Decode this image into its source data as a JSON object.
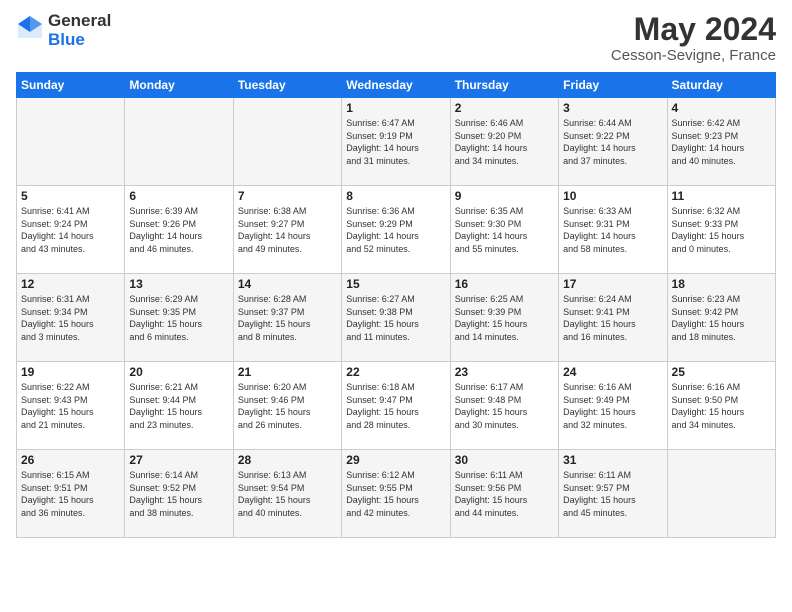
{
  "logo": {
    "general": "General",
    "blue": "Blue"
  },
  "title": "May 2024",
  "subtitle": "Cesson-Sevigne, France",
  "headers": [
    "Sunday",
    "Monday",
    "Tuesday",
    "Wednesday",
    "Thursday",
    "Friday",
    "Saturday"
  ],
  "weeks": [
    [
      {
        "day": "",
        "info": ""
      },
      {
        "day": "",
        "info": ""
      },
      {
        "day": "",
        "info": ""
      },
      {
        "day": "1",
        "info": "Sunrise: 6:47 AM\nSunset: 9:19 PM\nDaylight: 14 hours\nand 31 minutes."
      },
      {
        "day": "2",
        "info": "Sunrise: 6:46 AM\nSunset: 9:20 PM\nDaylight: 14 hours\nand 34 minutes."
      },
      {
        "day": "3",
        "info": "Sunrise: 6:44 AM\nSunset: 9:22 PM\nDaylight: 14 hours\nand 37 minutes."
      },
      {
        "day": "4",
        "info": "Sunrise: 6:42 AM\nSunset: 9:23 PM\nDaylight: 14 hours\nand 40 minutes."
      }
    ],
    [
      {
        "day": "5",
        "info": "Sunrise: 6:41 AM\nSunset: 9:24 PM\nDaylight: 14 hours\nand 43 minutes."
      },
      {
        "day": "6",
        "info": "Sunrise: 6:39 AM\nSunset: 9:26 PM\nDaylight: 14 hours\nand 46 minutes."
      },
      {
        "day": "7",
        "info": "Sunrise: 6:38 AM\nSunset: 9:27 PM\nDaylight: 14 hours\nand 49 minutes."
      },
      {
        "day": "8",
        "info": "Sunrise: 6:36 AM\nSunset: 9:29 PM\nDaylight: 14 hours\nand 52 minutes."
      },
      {
        "day": "9",
        "info": "Sunrise: 6:35 AM\nSunset: 9:30 PM\nDaylight: 14 hours\nand 55 minutes."
      },
      {
        "day": "10",
        "info": "Sunrise: 6:33 AM\nSunset: 9:31 PM\nDaylight: 14 hours\nand 58 minutes."
      },
      {
        "day": "11",
        "info": "Sunrise: 6:32 AM\nSunset: 9:33 PM\nDaylight: 15 hours\nand 0 minutes."
      }
    ],
    [
      {
        "day": "12",
        "info": "Sunrise: 6:31 AM\nSunset: 9:34 PM\nDaylight: 15 hours\nand 3 minutes."
      },
      {
        "day": "13",
        "info": "Sunrise: 6:29 AM\nSunset: 9:35 PM\nDaylight: 15 hours\nand 6 minutes."
      },
      {
        "day": "14",
        "info": "Sunrise: 6:28 AM\nSunset: 9:37 PM\nDaylight: 15 hours\nand 8 minutes."
      },
      {
        "day": "15",
        "info": "Sunrise: 6:27 AM\nSunset: 9:38 PM\nDaylight: 15 hours\nand 11 minutes."
      },
      {
        "day": "16",
        "info": "Sunrise: 6:25 AM\nSunset: 9:39 PM\nDaylight: 15 hours\nand 14 minutes."
      },
      {
        "day": "17",
        "info": "Sunrise: 6:24 AM\nSunset: 9:41 PM\nDaylight: 15 hours\nand 16 minutes."
      },
      {
        "day": "18",
        "info": "Sunrise: 6:23 AM\nSunset: 9:42 PM\nDaylight: 15 hours\nand 18 minutes."
      }
    ],
    [
      {
        "day": "19",
        "info": "Sunrise: 6:22 AM\nSunset: 9:43 PM\nDaylight: 15 hours\nand 21 minutes."
      },
      {
        "day": "20",
        "info": "Sunrise: 6:21 AM\nSunset: 9:44 PM\nDaylight: 15 hours\nand 23 minutes."
      },
      {
        "day": "21",
        "info": "Sunrise: 6:20 AM\nSunset: 9:46 PM\nDaylight: 15 hours\nand 26 minutes."
      },
      {
        "day": "22",
        "info": "Sunrise: 6:18 AM\nSunset: 9:47 PM\nDaylight: 15 hours\nand 28 minutes."
      },
      {
        "day": "23",
        "info": "Sunrise: 6:17 AM\nSunset: 9:48 PM\nDaylight: 15 hours\nand 30 minutes."
      },
      {
        "day": "24",
        "info": "Sunrise: 6:16 AM\nSunset: 9:49 PM\nDaylight: 15 hours\nand 32 minutes."
      },
      {
        "day": "25",
        "info": "Sunrise: 6:16 AM\nSunset: 9:50 PM\nDaylight: 15 hours\nand 34 minutes."
      }
    ],
    [
      {
        "day": "26",
        "info": "Sunrise: 6:15 AM\nSunset: 9:51 PM\nDaylight: 15 hours\nand 36 minutes."
      },
      {
        "day": "27",
        "info": "Sunrise: 6:14 AM\nSunset: 9:52 PM\nDaylight: 15 hours\nand 38 minutes."
      },
      {
        "day": "28",
        "info": "Sunrise: 6:13 AM\nSunset: 9:54 PM\nDaylight: 15 hours\nand 40 minutes."
      },
      {
        "day": "29",
        "info": "Sunrise: 6:12 AM\nSunset: 9:55 PM\nDaylight: 15 hours\nand 42 minutes."
      },
      {
        "day": "30",
        "info": "Sunrise: 6:11 AM\nSunset: 9:56 PM\nDaylight: 15 hours\nand 44 minutes."
      },
      {
        "day": "31",
        "info": "Sunrise: 6:11 AM\nSunset: 9:57 PM\nDaylight: 15 hours\nand 45 minutes."
      },
      {
        "day": "",
        "info": ""
      }
    ]
  ]
}
